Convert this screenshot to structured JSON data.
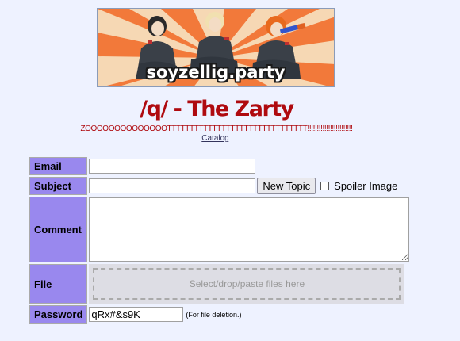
{
  "banner": {
    "text": "soyzellig.party",
    "colors": {
      "ray_orange": "#f2793a",
      "ray_cream": "#f6d8b4",
      "uniform": "#3a4048"
    }
  },
  "board": {
    "title": "/q/ - The Zarty",
    "subtitle": "ZOOOOOOOOOOOOOOTTTTTTTTTTTTTTTTTTTTTTTTTTTTTTT!!!!!!!!!!!!!!!!!!!!!!!!",
    "catalog_label": "Catalog",
    "title_color": "#af0a0f"
  },
  "form": {
    "email_label": "Email",
    "email_value": "",
    "subject_label": "Subject",
    "subject_value": "",
    "new_topic_label": "New Topic",
    "spoiler_label": "Spoiler Image",
    "comment_label": "Comment",
    "comment_value": "",
    "file_label": "File",
    "file_drop_text": "Select/drop/paste files here",
    "password_label": "Password",
    "password_value": "qRx#&s9K",
    "password_note": "(For file deletion.)",
    "header_color": "#9988ee"
  }
}
